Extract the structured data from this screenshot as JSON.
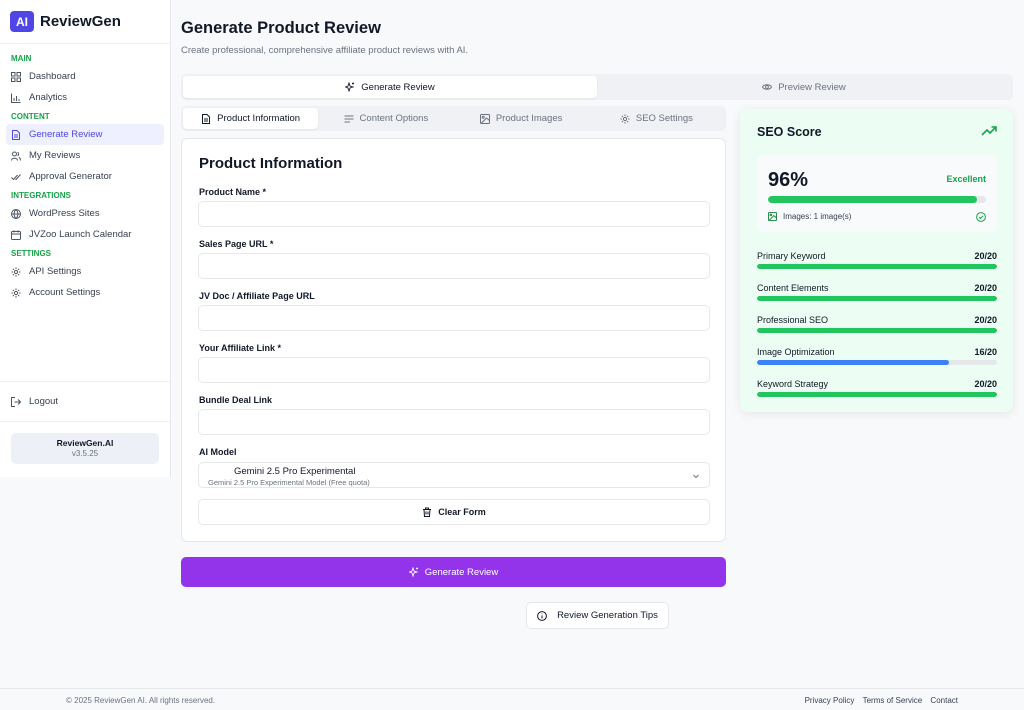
{
  "brand": {
    "badge": "AI",
    "name": "ReviewGen"
  },
  "sidebar": {
    "sections": [
      {
        "title": "MAIN",
        "items": [
          {
            "label": "Dashboard",
            "icon": "grid-icon"
          },
          {
            "label": "Analytics",
            "icon": "bar-chart-icon"
          }
        ]
      },
      {
        "title": "CONTENT",
        "items": [
          {
            "label": "Generate Review",
            "icon": "document-icon",
            "active": true
          },
          {
            "label": "My Reviews",
            "icon": "users-icon"
          },
          {
            "label": "Approval Generator",
            "icon": "check-double-icon"
          }
        ]
      },
      {
        "title": "INTEGRATIONS",
        "items": [
          {
            "label": "WordPress Sites",
            "icon": "globe-icon"
          },
          {
            "label": "JVZoo Launch Calendar",
            "icon": "calendar-icon"
          }
        ]
      },
      {
        "title": "SETTINGS",
        "items": [
          {
            "label": "API Settings",
            "icon": "gear-icon"
          },
          {
            "label": "Account Settings",
            "icon": "gear-icon"
          }
        ]
      }
    ],
    "logout": "Logout",
    "version_name": "ReviewGen.AI",
    "version_num": "v3.5.25"
  },
  "header": {
    "title": "Generate Product Review",
    "subtitle": "Create professional, comprehensive affiliate product reviews with AI."
  },
  "top_tabs": [
    {
      "label": "Generate Review",
      "active": true
    },
    {
      "label": "Preview Review",
      "active": false
    }
  ],
  "sub_tabs": [
    {
      "label": "Product Information",
      "active": true
    },
    {
      "label": "Content Options"
    },
    {
      "label": "Product Images"
    },
    {
      "label": "SEO Settings"
    }
  ],
  "form": {
    "title": "Product Information",
    "fields": [
      {
        "label": "Product Name *",
        "value": ""
      },
      {
        "label": "Sales Page URL *",
        "value": ""
      },
      {
        "label": "JV Doc / Affiliate Page URL",
        "value": ""
      },
      {
        "label": "Your Affiliate Link *",
        "value": ""
      },
      {
        "label": "Bundle Deal Link",
        "value": ""
      }
    ],
    "ai_model_label": "AI Model",
    "ai_model_value": "Gemini 2.5 Pro Experimental",
    "ai_model_desc": "Gemini 2.5 Pro Experimental Model (Free quota)",
    "clear_label": "Clear Form"
  },
  "generate_label": "Generate Review",
  "tips_label": "Review Generation Tips",
  "seo": {
    "title": "SEO Score",
    "score": "96%",
    "score_fraction": 0.96,
    "rating": "Excellent",
    "images_text": "Images: 1 image(s)",
    "metrics": [
      {
        "label": "Primary Keyword",
        "value": "20/20",
        "fraction": 1.0,
        "color": "#22c55e"
      },
      {
        "label": "Content Elements",
        "value": "20/20",
        "fraction": 1.0,
        "color": "#22c55e"
      },
      {
        "label": "Professional SEO",
        "value": "20/20",
        "fraction": 1.0,
        "color": "#22c55e"
      },
      {
        "label": "Image Optimization",
        "value": "16/20",
        "fraction": 0.8,
        "color": "#3b82f6"
      },
      {
        "label": "Keyword Strategy",
        "value": "20/20",
        "fraction": 1.0,
        "color": "#22c55e"
      }
    ]
  },
  "footer": {
    "copyright": "© 2025 ReviewGen AI. All rights reserved.",
    "links": [
      "Privacy Policy",
      "Terms of Service",
      "Contact"
    ]
  }
}
